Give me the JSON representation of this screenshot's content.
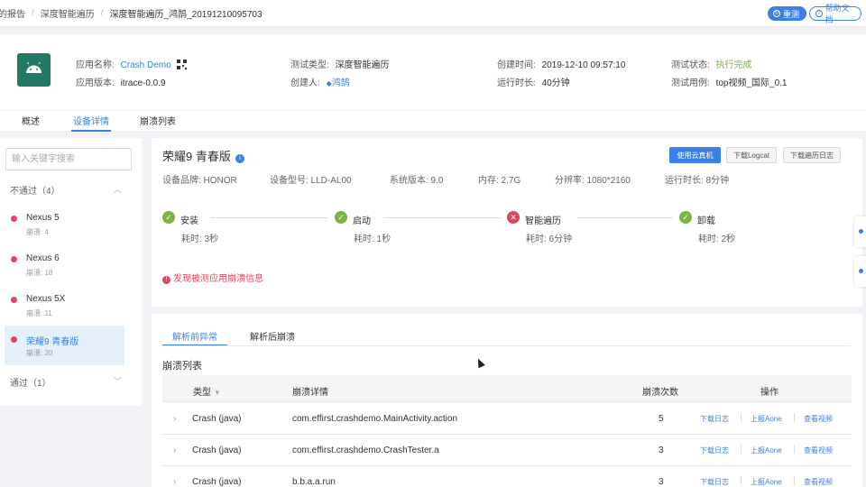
{
  "breadcrumb": [
    "我的报告",
    "深度智能遍历",
    "深度智能遍历_鸿鹄_20191210095703"
  ],
  "top_buttons": {
    "refresh": "重测",
    "help": "帮助文档"
  },
  "app_info": {
    "app_name_label": "应用名称:",
    "app_name": "Crash Demo",
    "app_version_label": "应用版本:",
    "app_version": "itrace-0.0.9",
    "test_type_label": "测试类型:",
    "test_type": "深度智能遍历",
    "creator_label": "创建人:",
    "creator": "鸿鹄",
    "created_label": "创建时间:",
    "created": "2019-12-10 09:57:10",
    "duration_label": "运行时长:",
    "duration": "40分钟",
    "status_label": "测试状态:",
    "status": "执行完成",
    "case_label": "测试用例:",
    "case": "top视频_国际_0.1"
  },
  "tabs": [
    "概述",
    "设备详情",
    "崩溃列表"
  ],
  "sidebar": {
    "search_placeholder": "输入关键字搜索",
    "failed_group": "不通过（4）",
    "passed_group": "通过（1）",
    "devices": [
      {
        "name": "Nexus 5",
        "crashes": "崩溃: 4"
      },
      {
        "name": "Nexus 6",
        "crashes": "崩溃: 18"
      },
      {
        "name": "Nexus 5X",
        "crashes": "崩溃: 11"
      },
      {
        "name": "荣耀9 青春版",
        "crashes": "崩溃: 20"
      }
    ]
  },
  "device": {
    "title": "荣耀9 青春版",
    "buttons": {
      "cloud": "使用云真机",
      "logcat": "下载Logcat",
      "log": "下载遍历日志"
    },
    "specs": [
      "设备品牌: HONOR",
      "设备型号: LLD-AL00",
      "系统版本: 9.0",
      "内存: 2.7G",
      "分辨率: 1080*2160",
      "运行时长: 8分钟"
    ],
    "steps": [
      {
        "name": "安装",
        "time": "耗时: 3秒",
        "status": "ok"
      },
      {
        "name": "启动",
        "time": "耗时: 1秒",
        "status": "ok"
      },
      {
        "name": "智能遍历",
        "time": "耗时: 6分钟",
        "status": "fail"
      },
      {
        "name": "卸载",
        "time": "耗时: 2秒",
        "status": "ok"
      }
    ],
    "crash_note": "发现被测应用崩溃信息"
  },
  "crash_section": {
    "tabs": [
      "解析前异常",
      "解析后崩溃"
    ],
    "title": "崩溃列表",
    "headers": {
      "type": "类型",
      "detail": "崩溃详情",
      "count": "崩溃次数",
      "action": "操作"
    },
    "actions": [
      "下载日志",
      "上报Aone",
      "查看视频"
    ],
    "rows": [
      {
        "type": "Crash (java)",
        "detail": "com.effirst.crashdemo.MainActivity.action",
        "count": "5"
      },
      {
        "type": "Crash (java)",
        "detail": "com.effirst.crashdemo.CrashTester.a",
        "count": "3"
      },
      {
        "type": "Crash (java)",
        "detail": "b.b.a.a.run",
        "count": "3"
      }
    ]
  },
  "colors": {
    "accent": "#3b80e6",
    "success": "#7cb342",
    "danger": "#e0455b",
    "android_icon_bg": "#227966"
  }
}
